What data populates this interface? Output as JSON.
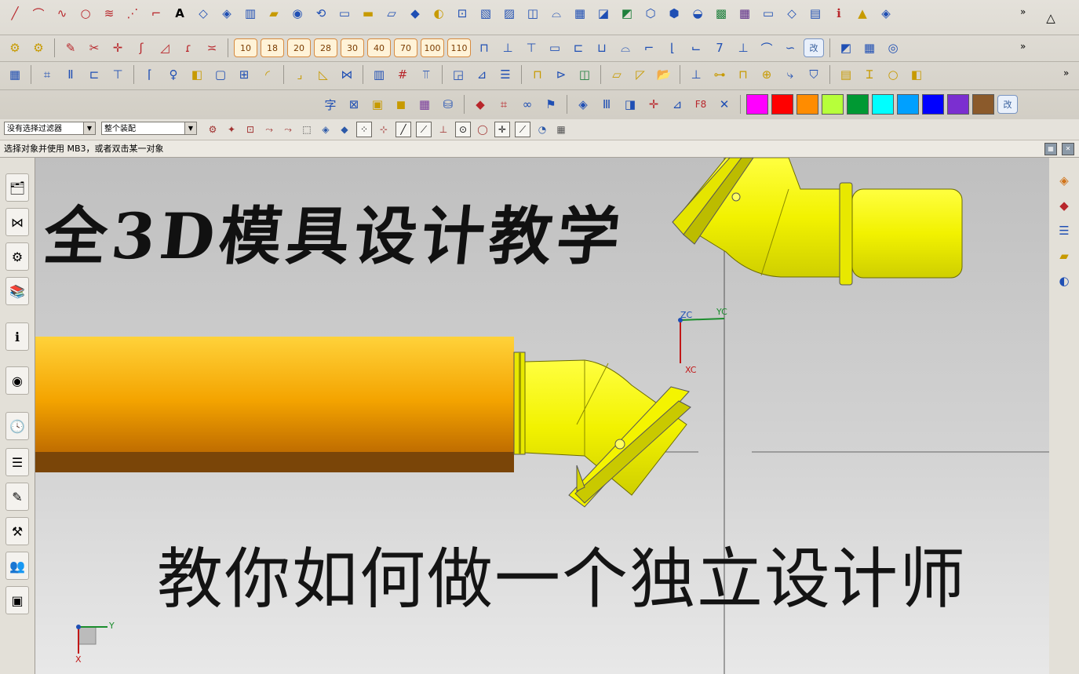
{
  "toolbar": {
    "row2_numbers": [
      "10",
      "18",
      "20",
      "28",
      "30",
      "40",
      "70",
      "100",
      "110"
    ],
    "modify_label": "改",
    "row4_text_icon": "字",
    "f8_label": "F8",
    "colors": [
      "#ff00ff",
      "#ff0000",
      "#ff8c00",
      "#b7ff3a",
      "#009933",
      "#00ffff",
      "#00a0ff",
      "#0000ff",
      "#7b2fd0",
      "#8b5a2b"
    ]
  },
  "filter_bar": {
    "type_filter": "没有选择过滤器",
    "scope_filter": "整个装配"
  },
  "status": {
    "prompt": "选择对象并使用 MB3，或者双击某一对象"
  },
  "viewport": {
    "overlay_title": "全3D模具设计教学",
    "overlay_subtitle": "教你如何做一个独立设计师",
    "wcs_labels": {
      "zc": "ZC",
      "yc": "YC",
      "xc": "XC"
    },
    "abs_triad": {
      "y": "Y",
      "x": "X"
    }
  },
  "colors": {
    "part_yellow": "#f2f200",
    "pipe_orange": "#f4a400",
    "pipe_brown": "#7a4508",
    "viewport_bg": "#cfcfcf"
  }
}
